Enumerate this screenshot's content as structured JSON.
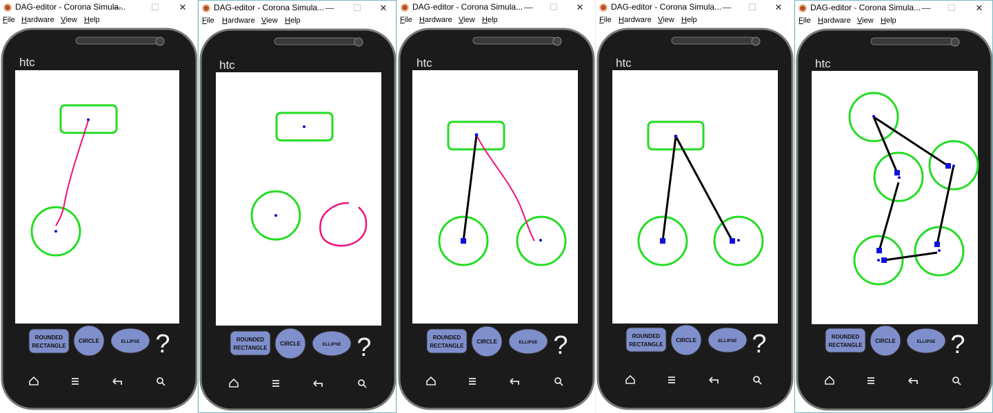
{
  "windows": [
    {
      "title": "DAG-editor - Corona Simula...",
      "menu": [
        "File",
        "Hardware",
        "View",
        "Help"
      ]
    },
    {
      "title": "DAG-editor - Corona Simula...",
      "menu": [
        "File",
        "Hardware",
        "View",
        "Help"
      ]
    },
    {
      "title": "DAG-editor - Corona Simula...",
      "menu": [
        "File",
        "Hardware",
        "View",
        "Help"
      ]
    },
    {
      "title": "DAG-editor - Corona Simula...",
      "menu": [
        "File",
        "Hardware",
        "View",
        "Help"
      ]
    },
    {
      "title": "DAG-editor - Corona Simula...",
      "menu": [
        "File",
        "Hardware",
        "View",
        "Help"
      ]
    }
  ],
  "phone": {
    "brand": "htc",
    "tools": {
      "rounded_rectangle_line1": "ROUNDED",
      "rounded_rectangle_line2": "RECTANGLE",
      "circle": "CIRCLE",
      "ellipse": "ELLIPSE",
      "help": "?"
    },
    "nav_icons": [
      "home-icon",
      "menu-icon",
      "back-icon",
      "search-icon"
    ]
  },
  "colors": {
    "node_stroke": "#22dd22",
    "stroke_in_progress": "#ee1177",
    "edge": "#000000",
    "anchor": "#1111dd",
    "tool_button": "#7f8fcc",
    "phone_body": "#1a1a1a"
  },
  "window_controls": {
    "minimize": "—",
    "maximize": "☐",
    "close": "✕"
  }
}
